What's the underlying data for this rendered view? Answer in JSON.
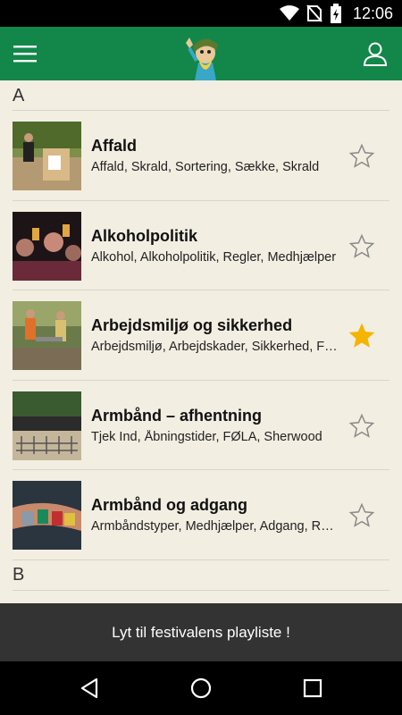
{
  "status_bar": {
    "time": "12:06",
    "icons": [
      "wifi-icon",
      "no-sim-icon",
      "battery-charging-icon"
    ]
  },
  "app_bar": {
    "left_icon": "hamburger-menu-icon",
    "logo": "festival-mascot-logo",
    "right_icon": "profile-icon"
  },
  "sections": [
    {
      "letter": "A",
      "items": [
        {
          "title": "Affald",
          "subtitle": "Affald, Skrald, Sortering, Sække, Skrald",
          "favorite": false
        },
        {
          "title": "Alkoholpolitik",
          "subtitle": "Alkohol, Alkoholpolitik, Regler, Medhjælper",
          "favorite": false
        },
        {
          "title": "Arbejdsmiljø og sikkerhed",
          "subtitle": "Arbejdsmiljø, Arbejdskader, Sikkerhed, Førstehjælp",
          "favorite": true
        },
        {
          "title": "Armbånd – afhentning",
          "subtitle": "Tjek Ind, Åbningstider, FØLA, Sherwood",
          "favorite": false
        },
        {
          "title": "Armbånd og adgang",
          "subtitle": "Armbåndstyper, Medhjælper, Adgang, Regler",
          "favorite": false
        }
      ]
    },
    {
      "letter": "B",
      "items": []
    }
  ],
  "banner": {
    "label": "Lyt til festivalens playliste !"
  },
  "nav_bar": {
    "icons": [
      "back-icon",
      "home-icon",
      "recents-icon"
    ]
  },
  "colors": {
    "primary": "#128749",
    "background": "#f2eee2",
    "star_active": "#f5b400",
    "star_inactive": "#8a8a8a",
    "banner": "#333333"
  }
}
